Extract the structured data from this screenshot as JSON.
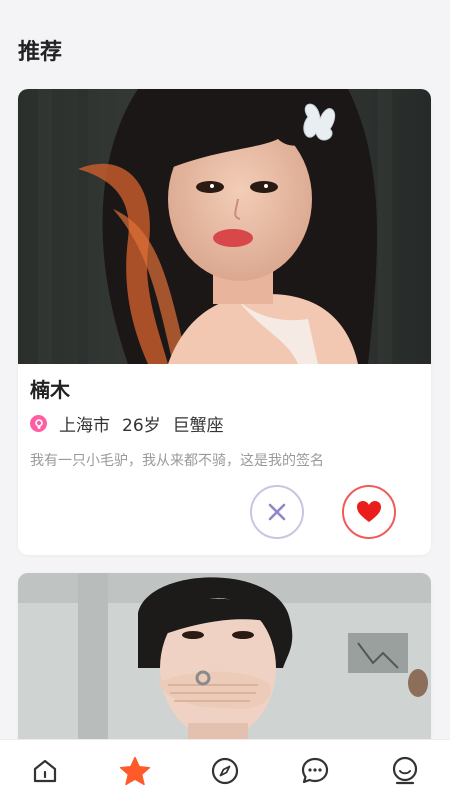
{
  "header": {
    "title": "推荐"
  },
  "cards": [
    {
      "name": "楠木",
      "gender": "female",
      "city": "上海市",
      "age": "26岁",
      "zodiac": "巨蟹座",
      "signature": "我有一只小毛驴，我从来都不骑，这是我的签名",
      "photo": "portrait-woman-long-dark-hair"
    },
    {
      "photo": "portrait-young-man-hand-over-mouth"
    }
  ],
  "actions": {
    "dislike_icon": "close-icon",
    "like_icon": "heart-icon"
  },
  "colors": {
    "accent_like": "#f25a5a",
    "dislike_border": "#c9c5df",
    "dislike_icon": "#8f89c4",
    "gender_badge": "#ff5fa2",
    "tab_active": "#ff5a2a",
    "tab_inactive": "#333333"
  },
  "tabbar": {
    "items": [
      {
        "icon": "home-icon",
        "active": false
      },
      {
        "icon": "star-icon",
        "active": true
      },
      {
        "icon": "compass-icon",
        "active": false
      },
      {
        "icon": "chat-icon",
        "active": false
      },
      {
        "icon": "profile-icon",
        "active": false
      }
    ]
  }
}
